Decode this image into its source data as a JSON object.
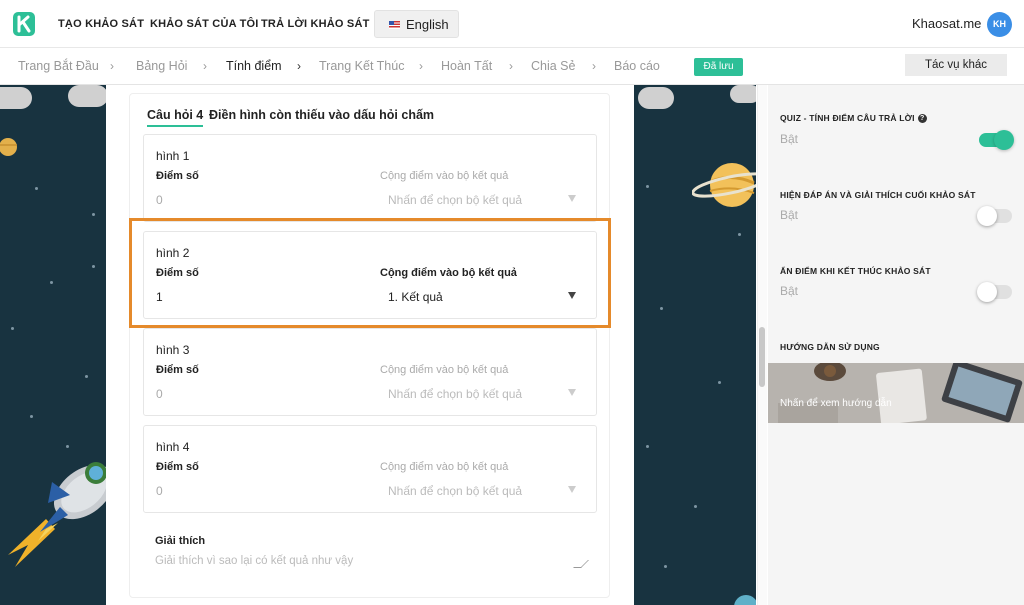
{
  "topnav": {
    "links": [
      "TẠO KHẢO SÁT",
      "KHẢO SÁT CỦA TÔI",
      "TRẢ LỜI KHẢO SÁT"
    ],
    "language": "English",
    "brand": "Khaosat.me",
    "avatar": "KH"
  },
  "steps": {
    "items": [
      "Trang Bắt Đầu",
      "Bảng Hỏi",
      "Tính điểm",
      "Trang Kết Thúc",
      "Hoàn Tất",
      "Chia Sẻ",
      "Báo cáo"
    ],
    "active": "Tính điểm",
    "saved_badge": "Đã lưu",
    "more_button": "Tác vụ khác"
  },
  "question": {
    "label": "Câu hỏi 4",
    "text": "Điền hình còn thiếu vào dấu hỏi chấm"
  },
  "options": [
    {
      "name": "hình 1",
      "score_label": "Điểm số",
      "score_value": "0",
      "add_label": "Cộng điểm vào bộ kết quả",
      "add_value": "Nhấn để chọn bộ kết quả",
      "selected": false
    },
    {
      "name": "hình 2",
      "score_label": "Điểm số",
      "score_value": "1",
      "add_label": "Cộng điểm vào bộ kết quả",
      "add_value": "1. Kết quả",
      "selected": true
    },
    {
      "name": "hình 3",
      "score_label": "Điểm số",
      "score_value": "0",
      "add_label": "Cộng điểm vào bộ kết quả",
      "add_value": "Nhấn để chọn bộ kết quả",
      "selected": false
    },
    {
      "name": "hình 4",
      "score_label": "Điểm số",
      "score_value": "0",
      "add_label": "Cộng điểm vào bộ kết quả",
      "add_value": "Nhấn để chọn bộ kết quả",
      "selected": false
    }
  ],
  "explanation": {
    "label": "Giải thích",
    "placeholder": "Giải thích vì sao lại có kết quả như vậy"
  },
  "settings": [
    {
      "title": "QUIZ - TÍNH ĐIỂM CÂU TRẢ LỜI",
      "value": "Bật",
      "on": true
    },
    {
      "title": "HIỆN ĐÁP ÁN VÀ GIẢI THÍCH CUỐI KHẢO SÁT",
      "value": "Bật",
      "on": false
    },
    {
      "title": "ẨN ĐIỂM KHI KẾT THÚC KHẢO SÁT",
      "value": "Bật",
      "on": false
    }
  ],
  "guide": {
    "title": "HƯỚNG DẪN SỬ DỤNG",
    "link": "Nhấn để xem hướng dẫn"
  },
  "colors": {
    "accent": "#2dbf97",
    "highlight": "#e58a2b",
    "space": "#183340"
  }
}
